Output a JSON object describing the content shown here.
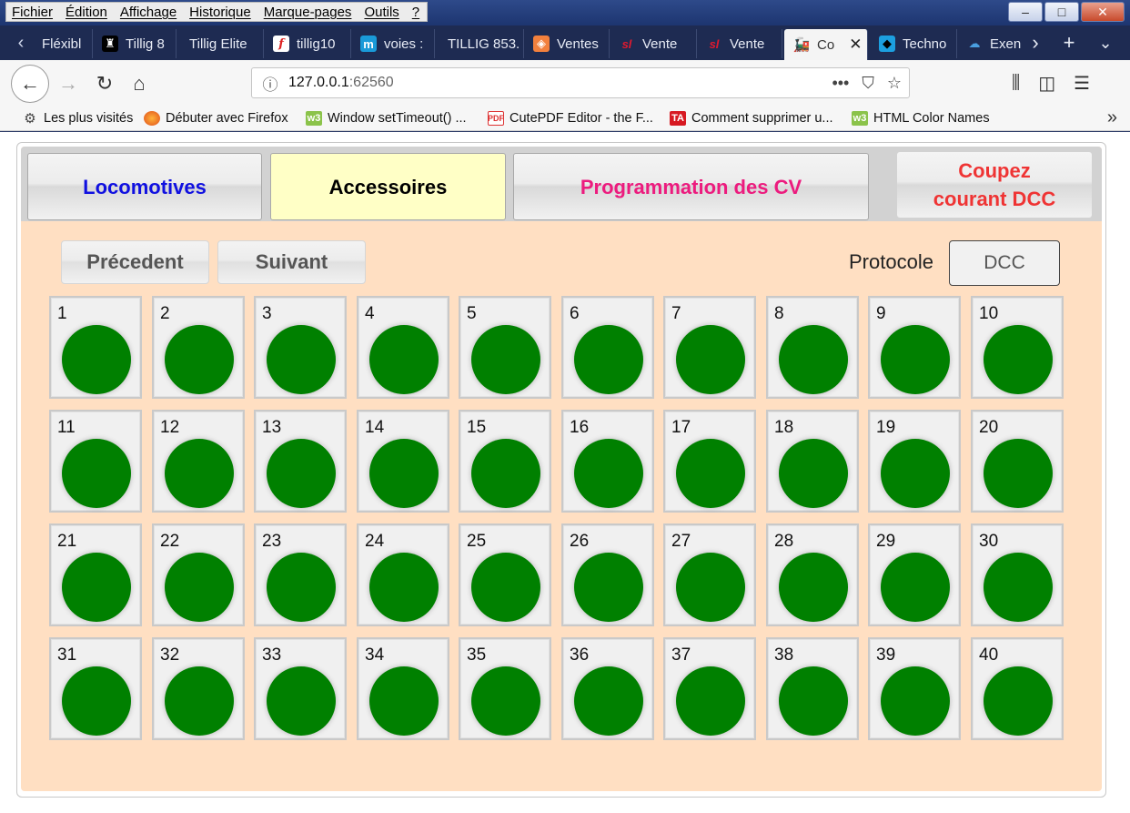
{
  "menu": [
    "Fichier",
    "Édition",
    "Affichage",
    "Historique",
    "Marque-pages",
    "Outils",
    "?"
  ],
  "window_buttons": {
    "minimize": "–",
    "maximize": "□",
    "close": "✕"
  },
  "tabs": [
    {
      "label": "Fléxibl",
      "icon": "fav-dark"
    },
    {
      "label": "Tillig 8",
      "icon": "fav-dark-figure"
    },
    {
      "label": "Tillig Elite",
      "icon": ""
    },
    {
      "label": "tillig10",
      "icon": "f-icon"
    },
    {
      "label": "voies :",
      "icon": "m-icon"
    },
    {
      "label": "TILLIG 853.",
      "icon": ""
    },
    {
      "label": "Ventes",
      "icon": "cube-icon"
    },
    {
      "label": "Vente",
      "icon": "sl-icon"
    },
    {
      "label": "Vente",
      "icon": "sl-icon"
    },
    {
      "label": "Co",
      "icon": "train-icon",
      "active": true
    },
    {
      "label": "Techno",
      "icon": "panda-icon"
    },
    {
      "label": "Exen",
      "icon": "cloud-icon"
    }
  ],
  "url": {
    "host": "127.0.0.1",
    "port": ":62560"
  },
  "bookmarks": [
    {
      "label": "Les plus visités",
      "icon": "gear-icon"
    },
    {
      "label": "Débuter avec Firefox",
      "icon": "firefox-icon"
    },
    {
      "label": "Window setTimeout() ...",
      "icon": "w3-icon"
    },
    {
      "label": "CutePDF Editor - the F...",
      "icon": "pdf-icon"
    },
    {
      "label": "Comment supprimer u...",
      "icon": "ta-icon"
    },
    {
      "label": "HTML Color Names",
      "icon": "w3-icon"
    }
  ],
  "app": {
    "nav": {
      "locomotives": "Locomotives",
      "accessoires": "Accessoires",
      "programmation": "Programmation des CV",
      "coupez_line1": "Coupez",
      "coupez_line2": "courant DCC"
    },
    "precedent": "Précedent",
    "suivant": "Suivant",
    "protocole_label": "Protocole",
    "protocole_value": "DCC",
    "accessories": [
      "1",
      "2",
      "3",
      "4",
      "5",
      "6",
      "7",
      "8",
      "9",
      "10",
      "11",
      "12",
      "13",
      "14",
      "15",
      "16",
      "17",
      "18",
      "19",
      "20",
      "21",
      "22",
      "23",
      "24",
      "25",
      "26",
      "27",
      "28",
      "29",
      "30",
      "31",
      "32",
      "33",
      "34",
      "35",
      "36",
      "37",
      "38",
      "39",
      "40"
    ],
    "led_color": "#008000"
  }
}
